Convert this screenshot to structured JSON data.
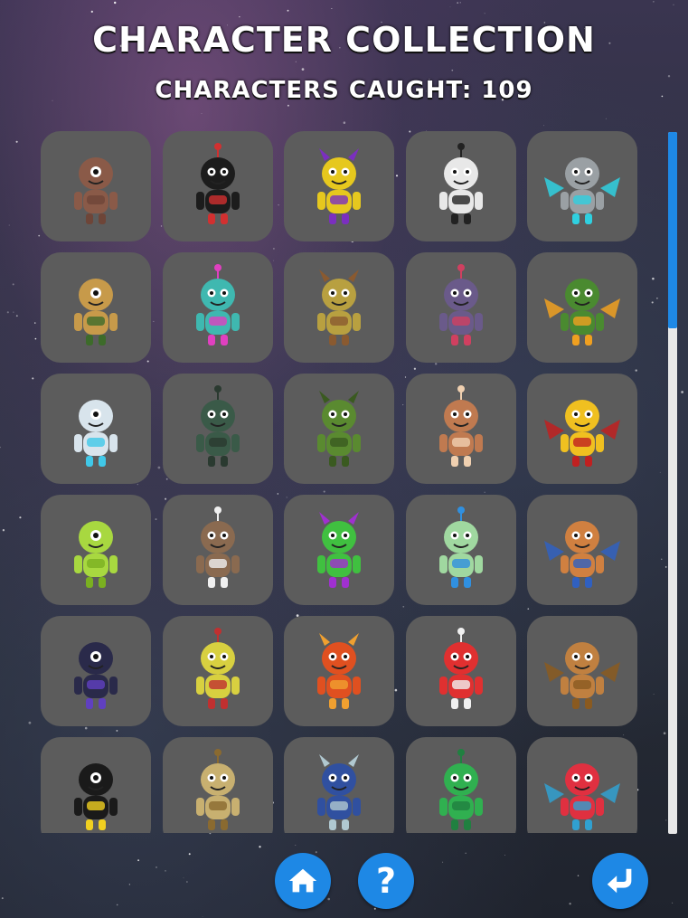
{
  "header": {
    "title": "CHARACTER COLLECTION",
    "caught_text": "CHARACTERS CAUGHT: 109"
  },
  "scroll": {
    "position_fraction": 0.28
  },
  "colors": {
    "accent": "#1e88e5",
    "tile": "#5c5c5c",
    "scroll_track": "#e8e8e8"
  },
  "characters": [
    {
      "name": "brown-gargoyle",
      "icon": "gargoyle-icon",
      "color": "#8a5a48",
      "accent": "#6e4538"
    },
    {
      "name": "black-horned-monster",
      "icon": "horned-monster-icon",
      "color": "#1c1c1c",
      "accent": "#d23030"
    },
    {
      "name": "clown-spiky-creature",
      "icon": "clown-creature-icon",
      "color": "#e6c81e",
      "accent": "#7b2fbf"
    },
    {
      "name": "skeleton-pirate",
      "icon": "skeleton-icon",
      "color": "#e8e8e8",
      "accent": "#222222"
    },
    {
      "name": "stone-golem",
      "icon": "golem-icon",
      "color": "#9aa0a4",
      "accent": "#2fd0e0"
    },
    {
      "name": "antenna-mushroom-kid",
      "icon": "mushroom-kid-icon",
      "color": "#c79a4a",
      "accent": "#3d6b2a"
    },
    {
      "name": "pink-cap-alien",
      "icon": "alien-cap-icon",
      "color": "#3fb8b0",
      "accent": "#e040c0"
    },
    {
      "name": "yellow-furry-monster",
      "icon": "furry-monster-icon",
      "color": "#b8a040",
      "accent": "#8a5a30"
    },
    {
      "name": "purple-flame-ghost",
      "icon": "flame-ghost-icon",
      "color": "#6a5a8a",
      "accent": "#d04060"
    },
    {
      "name": "green-helmet-robot",
      "icon": "robot-helmet-icon",
      "color": "#4a8a30",
      "accent": "#f0a020"
    },
    {
      "name": "white-ice-golem",
      "icon": "ice-golem-icon",
      "color": "#d8e4ec",
      "accent": "#40c8e8"
    },
    {
      "name": "green-bat",
      "icon": "bat-icon",
      "color": "#3a5a48",
      "accent": "#2a3a30"
    },
    {
      "name": "green-goblin",
      "icon": "goblin-icon",
      "color": "#5a8a30",
      "accent": "#3a5a20"
    },
    {
      "name": "brown-rabbit",
      "icon": "rabbit-icon",
      "color": "#c07a50",
      "accent": "#f0d0b0"
    },
    {
      "name": "red-mouth-monster",
      "icon": "red-mouth-monster-icon",
      "color": "#f0c020",
      "accent": "#c02020"
    },
    {
      "name": "one-eyed-alien",
      "icon": "cyclops-alien-icon",
      "color": "#a8d840",
      "accent": "#7ab020"
    },
    {
      "name": "white-rat",
      "icon": "rat-icon",
      "color": "#8a6a50",
      "accent": "#f0f0f0"
    },
    {
      "name": "green-antenna-bug",
      "icon": "bug-alien-icon",
      "color": "#40c040",
      "accent": "#a030d0"
    },
    {
      "name": "small-green-alien",
      "icon": "small-alien-icon",
      "color": "#a0d8a0",
      "accent": "#3090e0"
    },
    {
      "name": "orange-antenna-kid",
      "icon": "antenna-kid-icon",
      "color": "#d08040",
      "accent": "#3060c0"
    },
    {
      "name": "dark-reaper",
      "icon": "reaper-icon",
      "color": "#2a2a4a",
      "accent": "#6040c0"
    },
    {
      "name": "yellow-toothy-monster",
      "icon": "toothy-monster-icon",
      "color": "#d8d040",
      "accent": "#c03030"
    },
    {
      "name": "fire-blob",
      "icon": "fire-blob-icon",
      "color": "#e05020",
      "accent": "#f0a030"
    },
    {
      "name": "red-clown-robot",
      "icon": "clown-robot-icon",
      "color": "#e03030",
      "accent": "#f0f0f0"
    },
    {
      "name": "brown-lizard",
      "icon": "lizard-icon",
      "color": "#c08040",
      "accent": "#8a5a20"
    },
    {
      "name": "black-yellow-bee",
      "icon": "bee-icon",
      "color": "#1a1a1a",
      "accent": "#f0d020"
    },
    {
      "name": "turtle-kid",
      "icon": "turtle-icon",
      "color": "#c8b070",
      "accent": "#8a6a30"
    },
    {
      "name": "astronaut-alien",
      "icon": "astronaut-icon",
      "color": "#3050a0",
      "accent": "#b0c8d0"
    },
    {
      "name": "green-dragon",
      "icon": "dragon-icon",
      "color": "#30b050",
      "accent": "#208040"
    },
    {
      "name": "red-helmet-alien",
      "icon": "red-helmet-icon",
      "color": "#e03040",
      "accent": "#30a0d0"
    }
  ],
  "buttons": {
    "home_icon": "home-icon",
    "help_icon": "help-icon",
    "help_label": "?",
    "back_icon": "back-arrow-icon"
  }
}
